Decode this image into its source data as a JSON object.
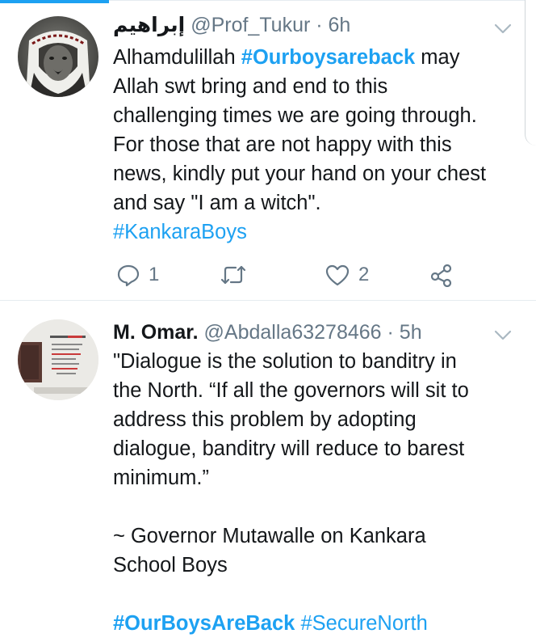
{
  "colors": {
    "accent": "#1da1f2",
    "text": "#14171a",
    "muted": "#657786",
    "divider": "#e6ecf0"
  },
  "tweets": [
    {
      "avatar_icon": "avatar-lion",
      "display_name": "إبراهيم",
      "handle": "@Prof_Tukur",
      "separator": "·",
      "time": "6h",
      "lines": [
        [
          {
            "t": "Alhamdulillah "
          },
          {
            "t": "#Ourboysareback",
            "tag": true,
            "bold": true
          },
          {
            "t": " may"
          }
        ],
        [
          {
            "t": "Allah swt bring and end to this"
          }
        ],
        [
          {
            "t": "challenging times we are going through."
          }
        ],
        [
          {
            "t": "For those that are not happy with this"
          }
        ],
        [
          {
            "t": "news, kindly put your hand on your chest"
          }
        ],
        [
          {
            "t": "and say \"I am a witch\"."
          }
        ],
        [
          {
            "t": "#KankaraBoys",
            "tag": true
          }
        ]
      ],
      "actions": {
        "reply_icon": "reply-icon",
        "reply_count": "1",
        "retweet_icon": "retweet-icon",
        "like_icon": "heart-icon",
        "like_count": "2",
        "share_icon": "share-icon"
      }
    },
    {
      "avatar_icon": "avatar-slide",
      "display_name": "M. Omar.",
      "handle": "@Abdalla63278466",
      "separator": "·",
      "time": "5h",
      "lines": [
        [
          {
            "t": "\"Dialogue is the solution to banditry in"
          }
        ],
        [
          {
            "t": "the North. “If all the governors will sit to"
          }
        ],
        [
          {
            "t": "address this problem by adopting"
          }
        ],
        [
          {
            "t": "dialogue, banditry will reduce to barest"
          }
        ],
        [
          {
            "t": "minimum.”"
          }
        ],
        [],
        [
          {
            "t": "~ Governor Mutawalle on Kankara"
          }
        ],
        [
          {
            "t": "School Boys"
          }
        ],
        [],
        [
          {
            "t": "#OurBoysAreBack",
            "tag": true,
            "bold": true
          },
          {
            "t": " "
          },
          {
            "t": "#SecureNorth",
            "tag": true
          }
        ]
      ]
    }
  ]
}
